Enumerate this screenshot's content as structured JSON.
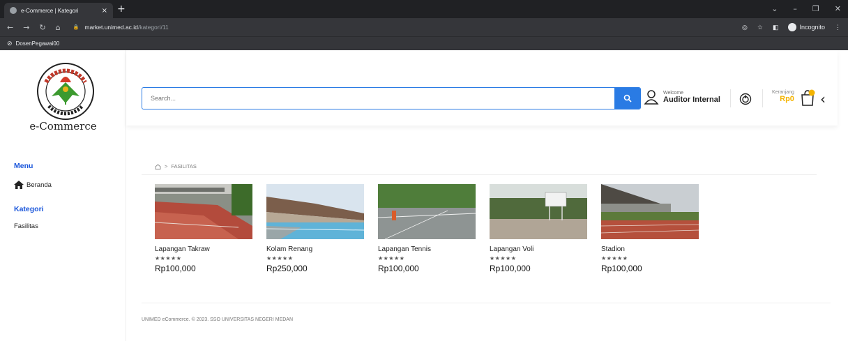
{
  "browser": {
    "tab_title": "e-Commerce | Kategori",
    "tab_close": "×",
    "new_tab": "+",
    "url_domain": "market.unimed.ac.id",
    "url_path": "/kategori/11",
    "profile_label": "Incognito",
    "bookmark": "DosenPegawai00"
  },
  "sidebar": {
    "brand": "e-Commerce",
    "menu_heading": "Menu",
    "menu_items": [
      {
        "label": "Beranda",
        "icon": "home-icon"
      }
    ],
    "category_heading": "Kategori",
    "categories": [
      {
        "label": "Fasilitas"
      }
    ]
  },
  "header": {
    "search_placeholder": "Search...",
    "welcome": "Welcome",
    "user_name": "Auditor Internal",
    "cart_label": "Keranjang",
    "cart_value": "Rp0",
    "cart_badge_color": "#f4b400",
    "accent": "#2a7be4"
  },
  "breadcrumb": {
    "icon": "home-outline-icon",
    "separator": ">",
    "current": "FASILITAS"
  },
  "products": [
    {
      "name": "Lapangan Takraw",
      "rating": "★★★★★",
      "price": "Rp100,000"
    },
    {
      "name": "Kolam Renang",
      "rating": "★★★★★",
      "price": "Rp250,000"
    },
    {
      "name": "Lapangan Tennis",
      "rating": "★★★★★",
      "price": "Rp100,000"
    },
    {
      "name": "Lapangan Voli",
      "rating": "★★★★★",
      "price": "Rp100,000"
    },
    {
      "name": "Stadion",
      "rating": "★★★★★",
      "price": "Rp100,000"
    }
  ],
  "footer": {
    "text": "UNIMED eCommerce. © 2023. SSO UNIVERSITAS NEGERI MEDAN"
  }
}
